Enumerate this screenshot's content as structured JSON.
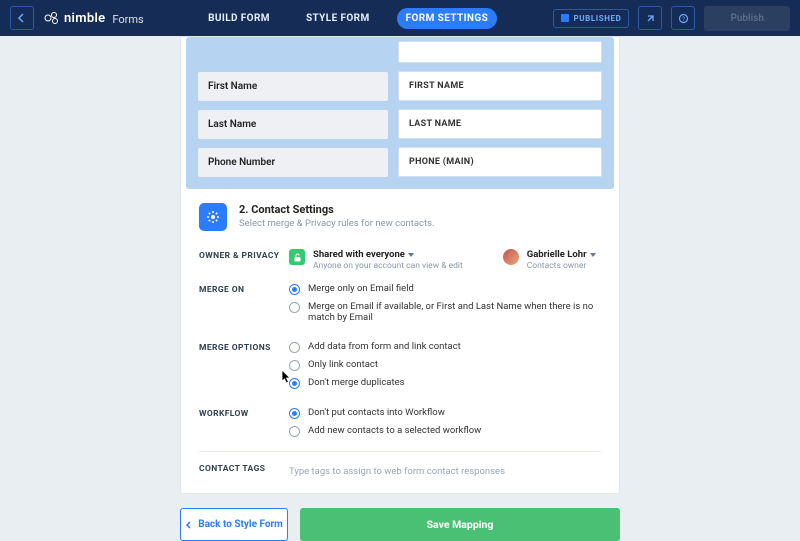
{
  "brand": {
    "name": "nimble",
    "suffix": "Forms"
  },
  "nav": {
    "build": "BUILD FORM",
    "style": "STYLE FORM",
    "settings": "FORM SETTINGS"
  },
  "status": {
    "published": "PUBLISHED",
    "publish_btn": "Publish"
  },
  "fields": [
    {
      "label": "First Name",
      "value": "FIRST NAME"
    },
    {
      "label": "Last Name",
      "value": "LAST NAME"
    },
    {
      "label": "Phone Number",
      "value": "PHONE (MAIN)"
    }
  ],
  "section": {
    "title": "2. Contact Settings",
    "sub": "Select merge & Privacy rules for new contacts."
  },
  "labels": {
    "owner": "OWNER & PRIVACY",
    "merge_on": "MERGE ON",
    "merge_opts": "MERGE OPTIONS",
    "workflow": "WORKFLOW",
    "tags": "CONTACT TAGS"
  },
  "owner": {
    "shared_title": "Shared with everyone",
    "shared_sub": "Anyone on your account can view & edit",
    "user_name": "Gabrielle Lohr",
    "user_sub": "Contacts owner"
  },
  "merge_on": {
    "opt1": "Merge only on Email field",
    "opt2": "Merge on Email if available, or First and Last Name when there is no match by Email"
  },
  "merge_opts": {
    "opt1": "Add data from form and link contact",
    "opt2": "Only link contact",
    "opt3": "Don't merge duplicates"
  },
  "workflow": {
    "opt1": "Don't put contacts into Workflow",
    "opt2": "Add new contacts to a selected workflow"
  },
  "tags_placeholder": "Type tags to assign to web form contact responses",
  "footer": {
    "back": "Back to Style Form",
    "save": "Save Mapping"
  }
}
